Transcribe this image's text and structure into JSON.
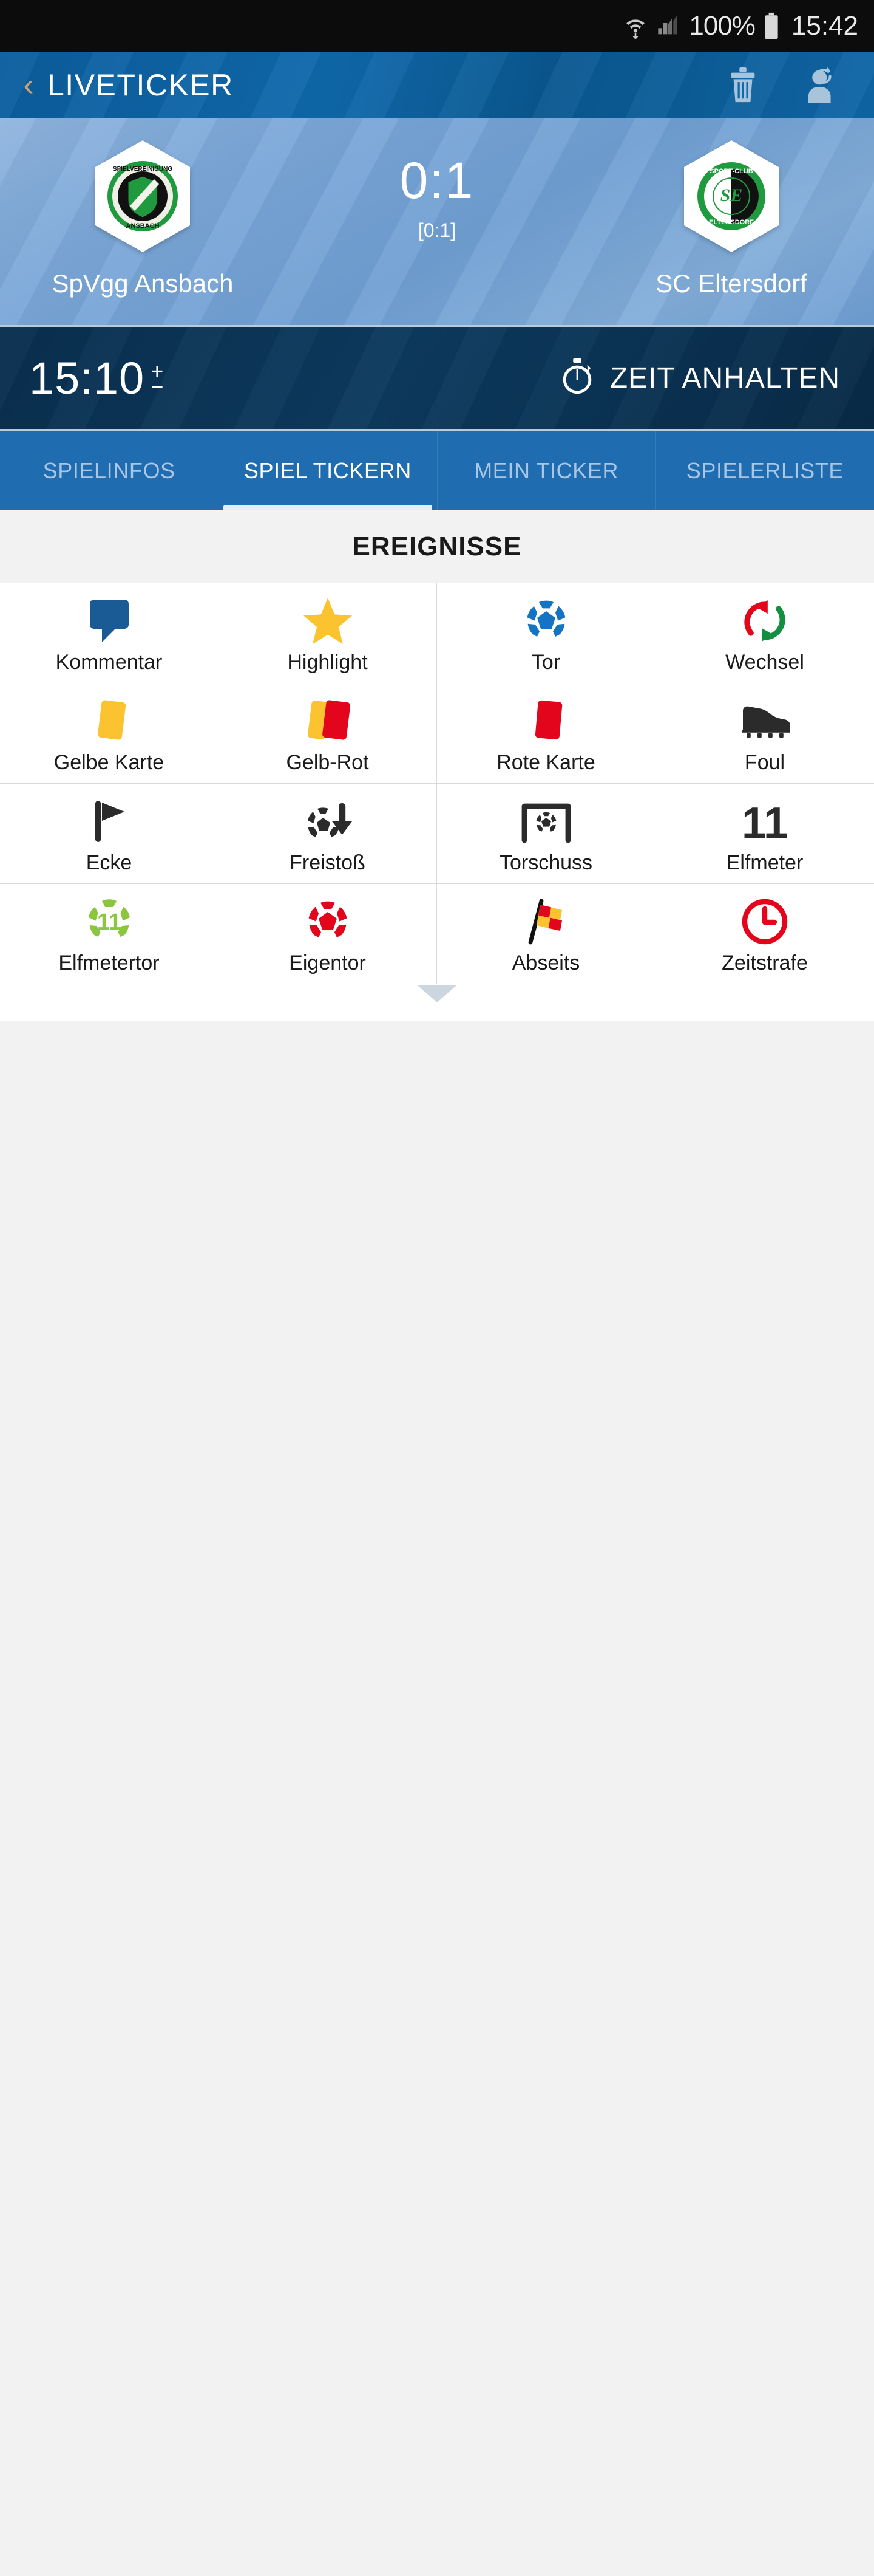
{
  "status_bar": {
    "wifi_icon": "wifi-icon",
    "signal_icon": "cellular-signal-icon",
    "battery_percent": "100%",
    "battery_icon": "battery-full-icon",
    "clock": "15:42"
  },
  "header": {
    "back_icon": "back-chevron-icon",
    "title": "LIVETICKER",
    "delete_icon": "trash-icon",
    "refresh_user_icon": "user-refresh-icon"
  },
  "scoreboard": {
    "home": {
      "name": "SpVgg Ansbach",
      "crest_icon": "spvgg-ansbach-crest-icon",
      "crest_text_outer": "SPIELVEREINIGUNG 09",
      "crest_text_bottom": "ANSBACH"
    },
    "away": {
      "name": "SC Eltersdorf",
      "crest_icon": "sc-eltersdorf-crest-icon",
      "crest_text_outer": "SPORT-CLUB",
      "crest_text_bottom": "ELTERSDORF"
    },
    "score": "0:1",
    "halftime_score": "[0:1]"
  },
  "timer_bar": {
    "clock": "15:10",
    "adjust_symbol_plus": "+",
    "adjust_symbol_minus": "−",
    "stopwatch_icon": "stopwatch-icon",
    "stop_label": "ZEIT ANHALTEN"
  },
  "tabs": [
    {
      "label": "SPIELINFOS",
      "active": false
    },
    {
      "label": "SPIEL TICKERN",
      "active": true
    },
    {
      "label": "MEIN TICKER",
      "active": false
    },
    {
      "label": "SPIELERLISTE",
      "active": false
    }
  ],
  "events_section": {
    "title": "EREIGNISSE",
    "items": [
      {
        "label": "Kommentar",
        "icon": "speech-bubble-icon"
      },
      {
        "label": "Highlight",
        "icon": "star-icon"
      },
      {
        "label": "Tor",
        "icon": "soccer-ball-blue-icon"
      },
      {
        "label": "Wechsel",
        "icon": "substitution-arrows-icon"
      },
      {
        "label": "Gelbe Karte",
        "icon": "yellow-card-icon"
      },
      {
        "label": "Gelb-Rot",
        "icon": "yellow-red-card-icon"
      },
      {
        "label": "Rote Karte",
        "icon": "red-card-icon"
      },
      {
        "label": "Foul",
        "icon": "football-boot-icon"
      },
      {
        "label": "Ecke",
        "icon": "corner-flag-icon"
      },
      {
        "label": "Freistoß",
        "icon": "ball-down-arrow-icon"
      },
      {
        "label": "Torschuss",
        "icon": "goal-with-ball-icon"
      },
      {
        "label": "Elfmeter",
        "icon": "eleven-number-icon"
      },
      {
        "label": "Elfmetertor",
        "icon": "eleven-green-ball-icon"
      },
      {
        "label": "Eigentor",
        "icon": "soccer-ball-red-icon"
      },
      {
        "label": "Abseits",
        "icon": "offside-flag-icon"
      },
      {
        "label": "Zeitstrafe",
        "icon": "clock-red-icon"
      }
    ]
  },
  "colors": {
    "header_blue": "#0f69ab",
    "tab_blue": "#1f6cb0",
    "timer_navy": "#0c3a5e",
    "accent_yellow": "#fbc02d",
    "accent_red": "#e3051b",
    "accent_green": "#1a9641"
  }
}
